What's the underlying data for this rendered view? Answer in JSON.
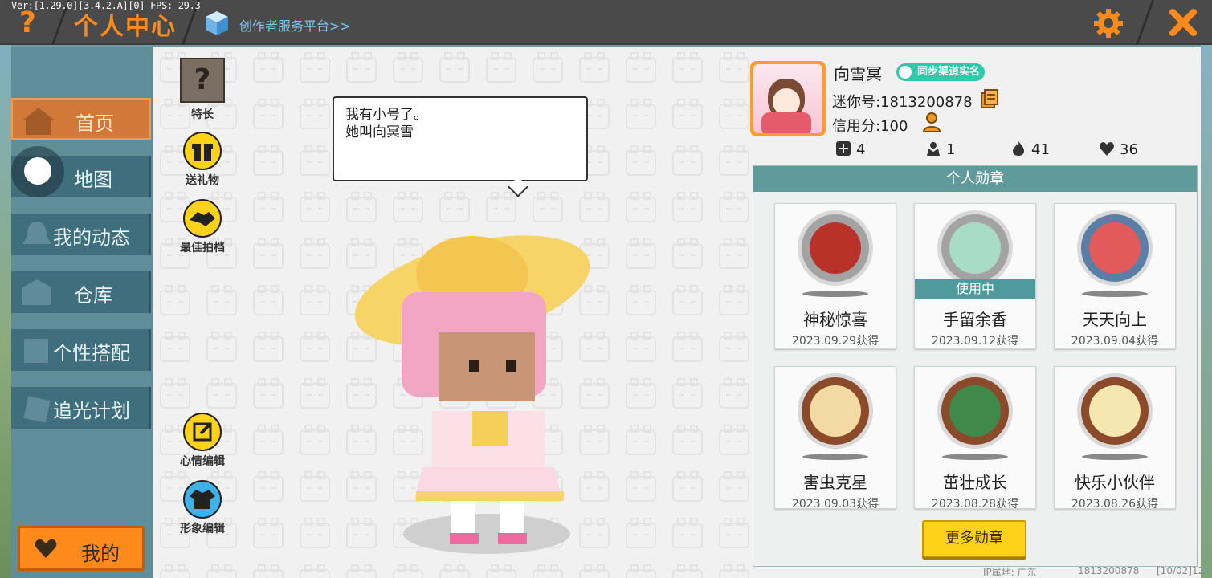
{
  "debug": {
    "version": "Ver:[1.29.0][3.4.2.A][0] FPS: 29.3"
  },
  "header": {
    "help_icon": "question-icon",
    "title": "个人中心",
    "creator_link": "创作者服务平台>>",
    "settings_icon": "gear-icon",
    "close_icon": "close-icon"
  },
  "nav": {
    "items": [
      {
        "label": "首页",
        "icon": "home-icon",
        "active": true
      },
      {
        "label": "地图",
        "icon": "map-icon",
        "active": false
      },
      {
        "label": "我的动态",
        "icon": "bell-icon",
        "active": false
      },
      {
        "label": "仓库",
        "icon": "warehouse-icon",
        "active": false
      },
      {
        "label": "个性搭配",
        "icon": "outfit-icon",
        "active": false
      },
      {
        "label": "追光计划",
        "icon": "light-plan-icon",
        "active": false
      }
    ],
    "mine": "我的"
  },
  "center": {
    "skill": "特长",
    "gift": "送礼物",
    "partner": "最佳拍档",
    "mood_edit": "心情编辑",
    "look_edit": "形象编辑",
    "speech_line1": "我有小号了。",
    "speech_line2": "她叫向冥雪"
  },
  "profile": {
    "name": "向雪冥",
    "verify_badge": "同步渠道实名",
    "mini_id": "迷你号:1813200878",
    "credit": "信用分:100",
    "stats": {
      "friends": "4",
      "fans": "1",
      "heat": "41",
      "likes": "36"
    }
  },
  "medals": {
    "title": "个人勋章",
    "in_use": "使用中",
    "items": [
      {
        "name": "神秘惊喜",
        "date": "2023.09.29获得"
      },
      {
        "name": "手留余香",
        "date": "2023.09.12获得"
      },
      {
        "name": "天天向上",
        "date": "2023.09.04获得"
      },
      {
        "name": "害虫克星",
        "date": "2023.09.03获得"
      },
      {
        "name": "茁壮成长",
        "date": "2023.08.28获得"
      },
      {
        "name": "快乐小伙伴",
        "date": "2023.08.26获得"
      }
    ],
    "more": "更多勋章"
  },
  "footer": {
    "ip": "IP属地: 广东",
    "uid": "1813200878",
    "date": "[10/02]12"
  },
  "colors": {
    "accent": "#ff8a1c",
    "nav": "#3f6e7d",
    "panel_head": "#5f9b9a",
    "button_yellow": "#ffd21a"
  }
}
